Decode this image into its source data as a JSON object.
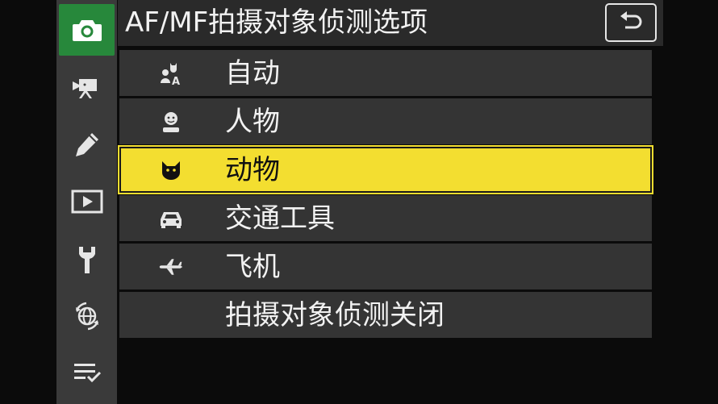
{
  "header": {
    "title": "AF/MF拍摄对象侦测选项",
    "back_icon": "return-icon"
  },
  "sidebar": {
    "items": [
      {
        "icon": "camera-icon",
        "active": true
      },
      {
        "icon": "movie-camera-icon",
        "active": false
      },
      {
        "icon": "pencil-icon",
        "active": false
      },
      {
        "icon": "playback-icon",
        "active": false
      },
      {
        "icon": "wrench-icon",
        "active": false
      },
      {
        "icon": "network-globe-icon",
        "active": false
      },
      {
        "icon": "my-menu-icon",
        "active": false
      }
    ]
  },
  "menu": {
    "items": [
      {
        "label": "自动",
        "icon": "auto-subject-icon"
      },
      {
        "label": "人物",
        "icon": "person-icon"
      },
      {
        "label": "动物",
        "icon": "cat-face-icon",
        "selected": true
      },
      {
        "label": "交通工具",
        "icon": "car-icon"
      },
      {
        "label": "飞机",
        "icon": "airplane-icon"
      },
      {
        "label": "拍摄对象侦测关闭",
        "icon": ""
      }
    ]
  },
  "colors": {
    "active_tab": "#27883b",
    "selected_row": "#f3de30",
    "row_bg": "#343434",
    "sidebar_bg": "#3a3a3a"
  }
}
